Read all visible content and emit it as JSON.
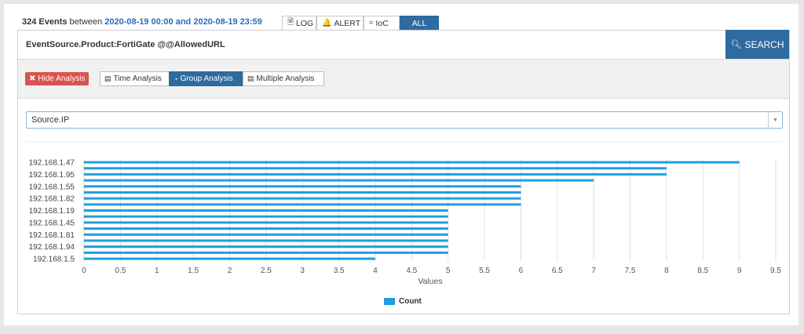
{
  "header": {
    "event_count": "324 Events",
    "between": "between",
    "date_range": "2020-08-19 00:00 and 2020-08-19 23:59"
  },
  "view_tabs": [
    {
      "label": "LOG",
      "icon": "document-icon"
    },
    {
      "label": "ALERT",
      "icon": "bell-icon"
    },
    {
      "label": "IoC",
      "icon": "fingerprint-icon"
    },
    {
      "label": "ALL",
      "active": true
    }
  ],
  "query": {
    "text": "EventSource.Product:FortiGate @@AllowedURL",
    "search_label": "SEARCH"
  },
  "analysis": {
    "hide_label": "Hide Analysis",
    "tabs": [
      {
        "label": "Time Analysis",
        "icon": "bar-chart-icon"
      },
      {
        "label": "Group Analysis",
        "icon": "pie-chart-icon",
        "active": true
      },
      {
        "label": "Multiple Analysis",
        "icon": "table-icon"
      }
    ]
  },
  "group_field": {
    "selected": "Source.IP"
  },
  "colors": {
    "bar": "#1e9ee0",
    "accent": "#2f6aa0",
    "danger": "#d9534f"
  },
  "chart_data": {
    "type": "bar",
    "orientation": "horizontal",
    "xlabel": "Values",
    "xlim": [
      0,
      9.5
    ],
    "xticks": [
      0,
      0.5,
      1,
      1.5,
      2,
      2.5,
      3,
      3.5,
      4,
      4.5,
      5,
      5.5,
      6,
      6.5,
      7,
      7.5,
      8,
      8.5,
      9,
      9.5
    ],
    "grid": "vertical",
    "legend": "bottom",
    "categories": [
      "192.168.1.47",
      "",
      "192.168.1.95",
      "",
      "192.168.1.55",
      "",
      "192.168.1.82",
      "",
      "192.168.1.19",
      "",
      "192.168.1.45",
      "",
      "192.168.1.81",
      "",
      "192.168.1.94",
      "",
      "192.168.1.5"
    ],
    "series": [
      {
        "name": "Count",
        "values": [
          9,
          8,
          8,
          7,
          6,
          6,
          6,
          6,
          5,
          5,
          5,
          5,
          5,
          5,
          5,
          5,
          4
        ]
      }
    ]
  }
}
